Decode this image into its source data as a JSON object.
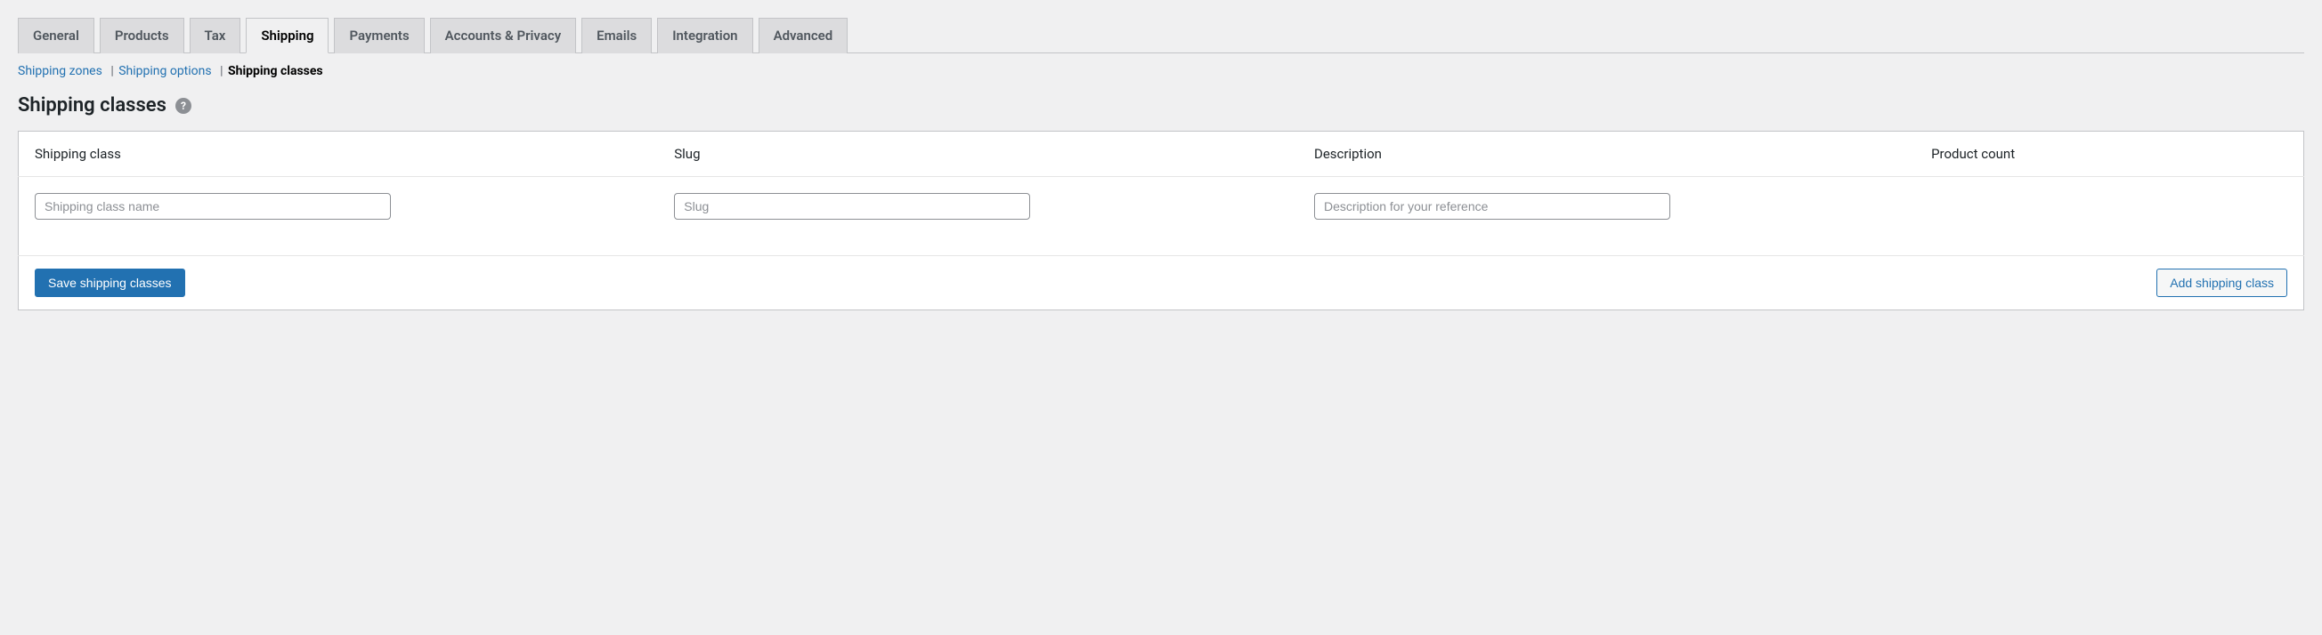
{
  "tabs": [
    {
      "label": "General",
      "active": false
    },
    {
      "label": "Products",
      "active": false
    },
    {
      "label": "Tax",
      "active": false
    },
    {
      "label": "Shipping",
      "active": true
    },
    {
      "label": "Payments",
      "active": false
    },
    {
      "label": "Accounts & Privacy",
      "active": false
    },
    {
      "label": "Emails",
      "active": false
    },
    {
      "label": "Integration",
      "active": false
    },
    {
      "label": "Advanced",
      "active": false
    }
  ],
  "subnav": {
    "zones": "Shipping zones",
    "options": "Shipping options",
    "classes": "Shipping classes"
  },
  "page": {
    "title": "Shipping classes",
    "help_tooltip": "?"
  },
  "table": {
    "headers": {
      "class": "Shipping class",
      "slug": "Slug",
      "description": "Description",
      "count": "Product count"
    },
    "row": {
      "class_placeholder": "Shipping class name",
      "class_value": "",
      "slug_placeholder": "Slug",
      "slug_value": "",
      "description_placeholder": "Description for your reference",
      "description_value": "",
      "count_value": ""
    }
  },
  "actions": {
    "save": "Save shipping classes",
    "add": "Add shipping class"
  }
}
